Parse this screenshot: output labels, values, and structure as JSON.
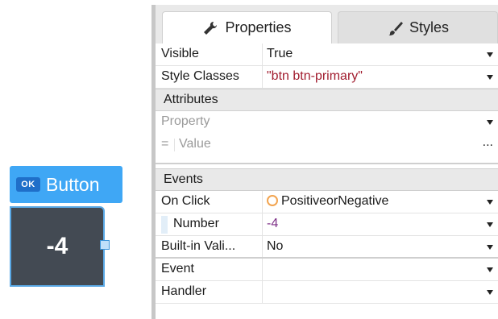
{
  "canvas": {
    "widget_badge": "OK",
    "widget_label": "Button",
    "button_value": "-4"
  },
  "tabs": [
    {
      "label": "Properties",
      "icon": "wrench-icon",
      "active": true
    },
    {
      "label": "Styles",
      "icon": "brush-icon",
      "active": false
    }
  ],
  "properties": {
    "visible": {
      "name": "Visible",
      "value": "True"
    },
    "style_classes": {
      "name": "Style Classes",
      "value": "\"btn btn-primary\""
    }
  },
  "attributes": {
    "section_label": "Attributes",
    "property_placeholder": "Property",
    "value_prefix": "=",
    "value_placeholder": "Value",
    "more": "..."
  },
  "events": {
    "section_label": "Events",
    "on_click": {
      "name": "On Click",
      "value": "PositiveorNegative"
    },
    "number": {
      "name": "Number",
      "value": "-4"
    },
    "builtin": {
      "name": "Built-in Vali...",
      "value": "No"
    },
    "event": {
      "name": "Event",
      "value": ""
    },
    "handler": {
      "name": "Handler",
      "value": ""
    }
  },
  "colors": {
    "accent": "#3fa7f5",
    "button_bg": "#434a53",
    "string_value": "#a11c2e",
    "number_value": "#7d2f86",
    "action_icon": "#f2a450"
  }
}
